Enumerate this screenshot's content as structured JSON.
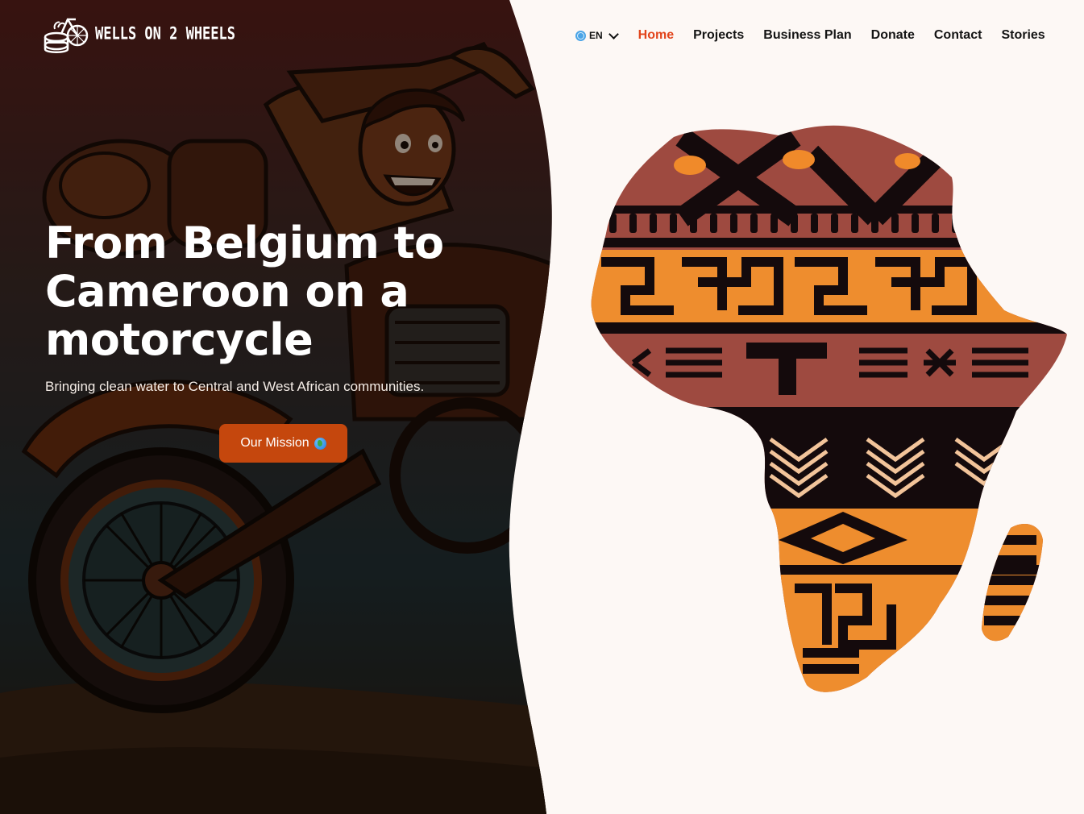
{
  "brand": {
    "name": "WELLS ON 2 WHEELS"
  },
  "nav": {
    "language": "EN",
    "items": [
      {
        "label": "Home",
        "active": true
      },
      {
        "label": "Projects",
        "active": false
      },
      {
        "label": "Business Plan",
        "active": false
      },
      {
        "label": "Donate",
        "active": false
      },
      {
        "label": "Contact",
        "active": false
      },
      {
        "label": "Stories",
        "active": false
      }
    ]
  },
  "hero": {
    "headline": "From Belgium to Cameroon on a motorcycle",
    "subheadline": "Bringing clean water to Central and West African communities.",
    "cta_label": "Our Mission",
    "cta_icon": "globe-emoji"
  },
  "colors": {
    "accent": "#c5470d",
    "nav_active": "#e2451c",
    "background": "#fdf8f5"
  }
}
